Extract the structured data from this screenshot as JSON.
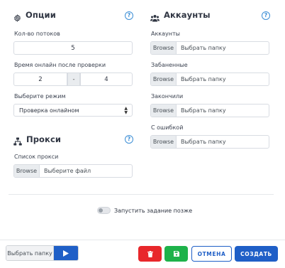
{
  "options": {
    "title": "Опции",
    "icon": "gear-icon",
    "threads_label": "Кол-во потоков",
    "threads_value": "5",
    "online_label": "Время онлайн после проверки",
    "online_from": "2",
    "online_sep": "-",
    "online_to": "4",
    "mode_label": "Выберите режим",
    "mode_value": "Проверка онлайном"
  },
  "proxy": {
    "title": "Прокси",
    "icon": "network-icon",
    "list_label": "Список прокси",
    "browse": "Browse",
    "placeholder": "Выберите файл"
  },
  "accounts": {
    "title": "Аккаунты",
    "icon": "users-icon",
    "browse": "Browse",
    "placeholder": "Выбрать папку",
    "fields": [
      {
        "label": "Аккаунты"
      },
      {
        "label": "Забаненные"
      },
      {
        "label": "Закончили"
      },
      {
        "label": "С ошибкой"
      }
    ]
  },
  "help_symbol": "?",
  "schedule": {
    "label": "Запустить задание позже",
    "enabled": false
  },
  "footer": {
    "folder_label": "Выбрать папку",
    "cancel_label": "ОТМЕНА",
    "create_label": "СОЗДАТЬ"
  },
  "colors": {
    "primary": "#1f5fc7",
    "danger": "#e8272b",
    "success": "#1eb24a",
    "help": "#3d8fd6"
  }
}
